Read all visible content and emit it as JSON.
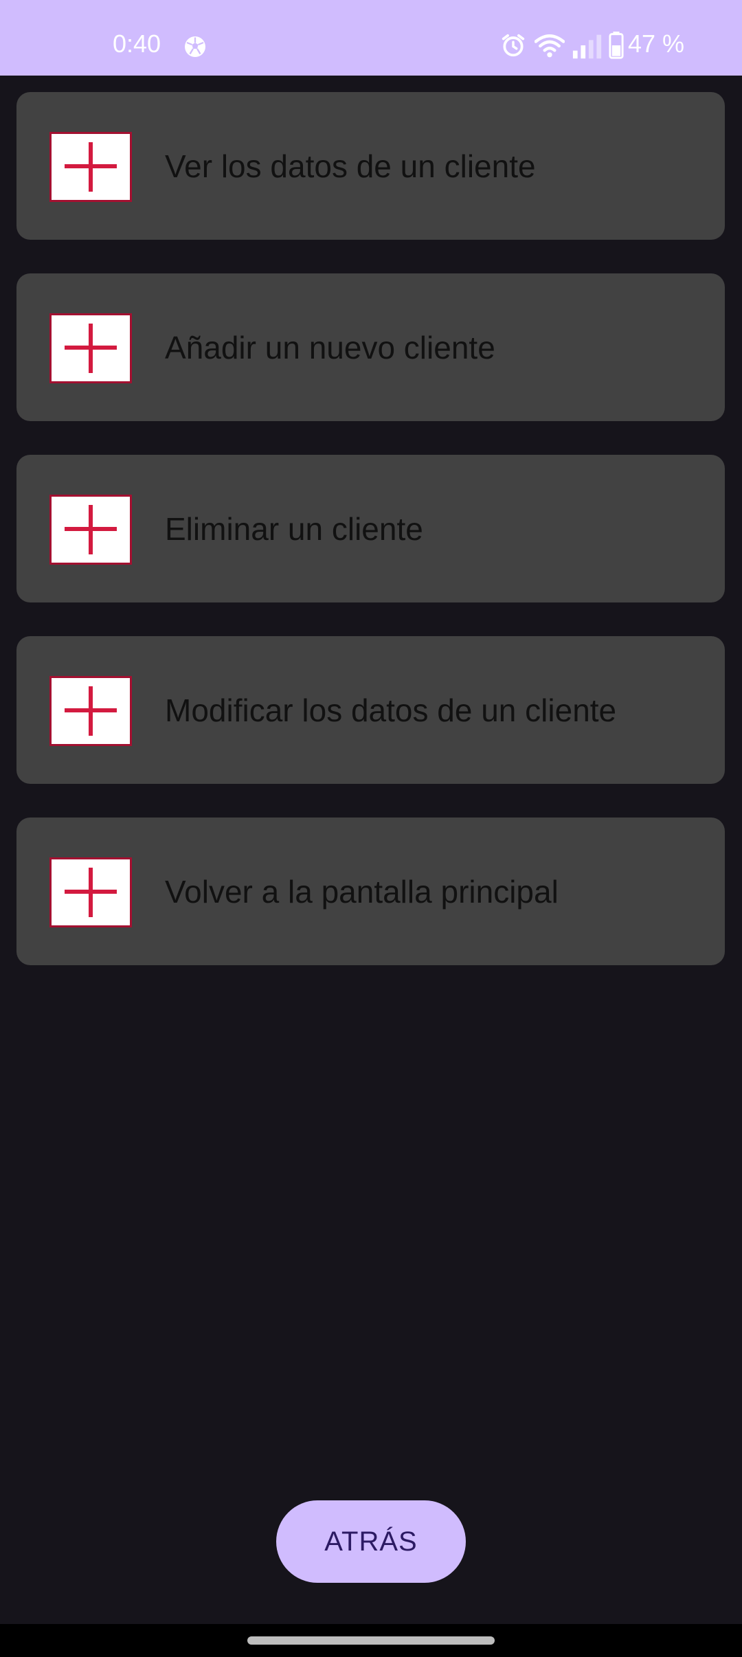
{
  "status_bar": {
    "time": "0:40",
    "battery_percent": "47 %",
    "icons": [
      "soccer-ball-icon",
      "alarm-icon",
      "wifi-icon",
      "signal-icon",
      "battery-icon"
    ],
    "background_color": "#d0bcfe"
  },
  "menu": {
    "items": [
      {
        "label": "Ver los datos de un cliente",
        "icon": "red-cross-flag-icon"
      },
      {
        "label": "Añadir un nuevo cliente",
        "icon": "red-cross-flag-icon"
      },
      {
        "label": "Eliminar un cliente",
        "icon": "red-cross-flag-icon"
      },
      {
        "label": "Modificar los datos de un cliente",
        "icon": "red-cross-flag-icon"
      },
      {
        "label": "Volver a la pantalla principal",
        "icon": "red-cross-flag-icon"
      }
    ],
    "card_color": "#424242"
  },
  "back_button": {
    "label": "ATRÁS",
    "color": "#d0bcfe"
  },
  "colors": {
    "background": "#16141b",
    "accent_red": "#d31a3f"
  }
}
